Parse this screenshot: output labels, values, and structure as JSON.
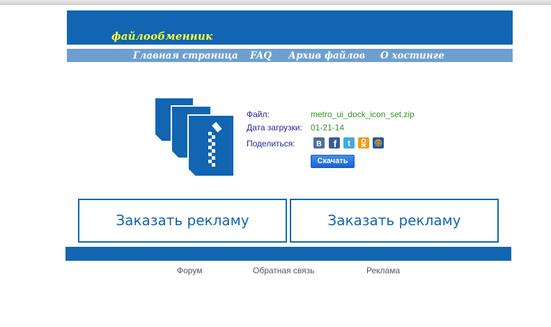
{
  "header": {
    "logo_text": "файлообменник"
  },
  "nav": {
    "items": [
      {
        "label": "Главная страница"
      },
      {
        "label": "FAQ"
      },
      {
        "label": "Архив файлов"
      },
      {
        "label": "О хостинге"
      }
    ]
  },
  "file_info": {
    "file_label": "Файл:",
    "file_name": "metro_ui_dock_icon_set.zip",
    "date_label": "Дата загрузки:",
    "date_value": "01-21-14",
    "share_label": "Поделиться:",
    "download_label": "Скачать"
  },
  "social": {
    "icons": [
      {
        "name": "vkontakte-icon",
        "glyph": "B",
        "color": "#4b6d9b"
      },
      {
        "name": "facebook-icon",
        "glyph": "f",
        "color": "#3b5998"
      },
      {
        "name": "twitter-icon",
        "glyph": "t",
        "color": "#3fa9e2"
      },
      {
        "name": "odnoklassniki-icon",
        "glyph": "ok",
        "color": "#f39a13"
      },
      {
        "name": "mailru-icon",
        "glyph": "@",
        "color": "#1a5ba6"
      }
    ]
  },
  "ads": {
    "left_label": "Заказать рекламу",
    "right_label": "Заказать рекламу"
  },
  "footer": {
    "links": [
      {
        "label": "Форум"
      },
      {
        "label": "Обратная связь"
      },
      {
        "label": "Реклама"
      }
    ]
  },
  "colors": {
    "primary": "#1265b1",
    "nav": "#6f9fcf",
    "logo": "#ffff33",
    "value_green": "#2e9420",
    "label_blue": "#1f1f9a"
  }
}
